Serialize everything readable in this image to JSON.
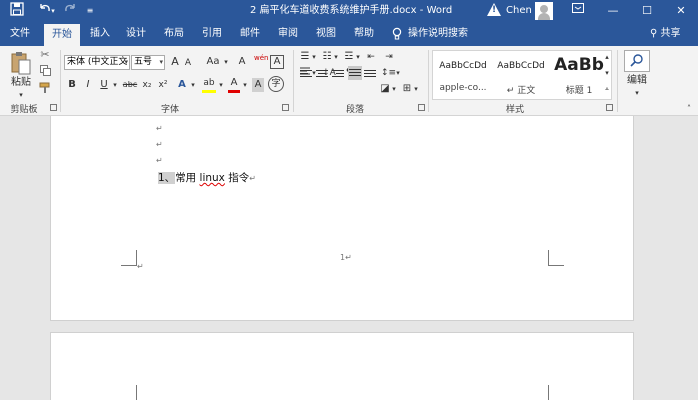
{
  "titlebar": {
    "title": "2 扁平化车道收费系统维护手册.docx - Word",
    "user": "Chen",
    "save_icon": "save-icon",
    "undo_icon": "undo-icon",
    "redo_icon": "redo-icon",
    "customize_icon": "customize-qat-icon",
    "warning_icon": "warning-icon",
    "ribbon_display_icon": "ribbon-display-options-icon",
    "minimize_label": "—",
    "maximize_label": "☐",
    "close_label": "✕"
  },
  "tabs": [
    "文件",
    "开始",
    "插入",
    "设计",
    "布局",
    "引用",
    "邮件",
    "审阅",
    "视图",
    "帮助"
  ],
  "active_tab": "开始",
  "tell_me": "操作说明搜索",
  "share": "共享",
  "ribbon": {
    "clipboard": {
      "label": "剪贴板",
      "paste": "粘贴"
    },
    "font": {
      "label": "字体",
      "font_name": "宋体 (中文正文",
      "font_size": "五号",
      "grow": "A",
      "shrink": "A",
      "change_case": "Aa",
      "clear_format": "A",
      "phonetic": "wén",
      "char_border": "A",
      "bold": "B",
      "italic": "I",
      "underline": "U",
      "strike": "abc",
      "subscript": "x₂",
      "superscript": "x²",
      "text_effects": "A",
      "highlight": "ab",
      "font_color": "A",
      "char_shading": "A",
      "enclose": "字"
    },
    "paragraph": {
      "label": "段落"
    },
    "styles": {
      "label": "样式",
      "items": [
        {
          "preview": "AaBbCcDd",
          "name": "apple-co..."
        },
        {
          "preview": "AaBbCcDd",
          "name": "↵ 正文"
        },
        {
          "preview": "AaBb",
          "name": "标题 1"
        }
      ]
    },
    "editing": {
      "label": "编辑"
    }
  },
  "document": {
    "para_mark": "↵",
    "list_number": "1、",
    "heading_text_a": "常用 ",
    "heading_text_b": "linux",
    "heading_text_c": " 指令",
    "footer_page_number": "1"
  },
  "colors": {
    "accent": "#2b579a",
    "ribbon_bg": "#f3f3f3",
    "workspace_bg": "#e6e6e6",
    "highlight_yellow": "#ffff00",
    "font_red": "#e00000"
  }
}
